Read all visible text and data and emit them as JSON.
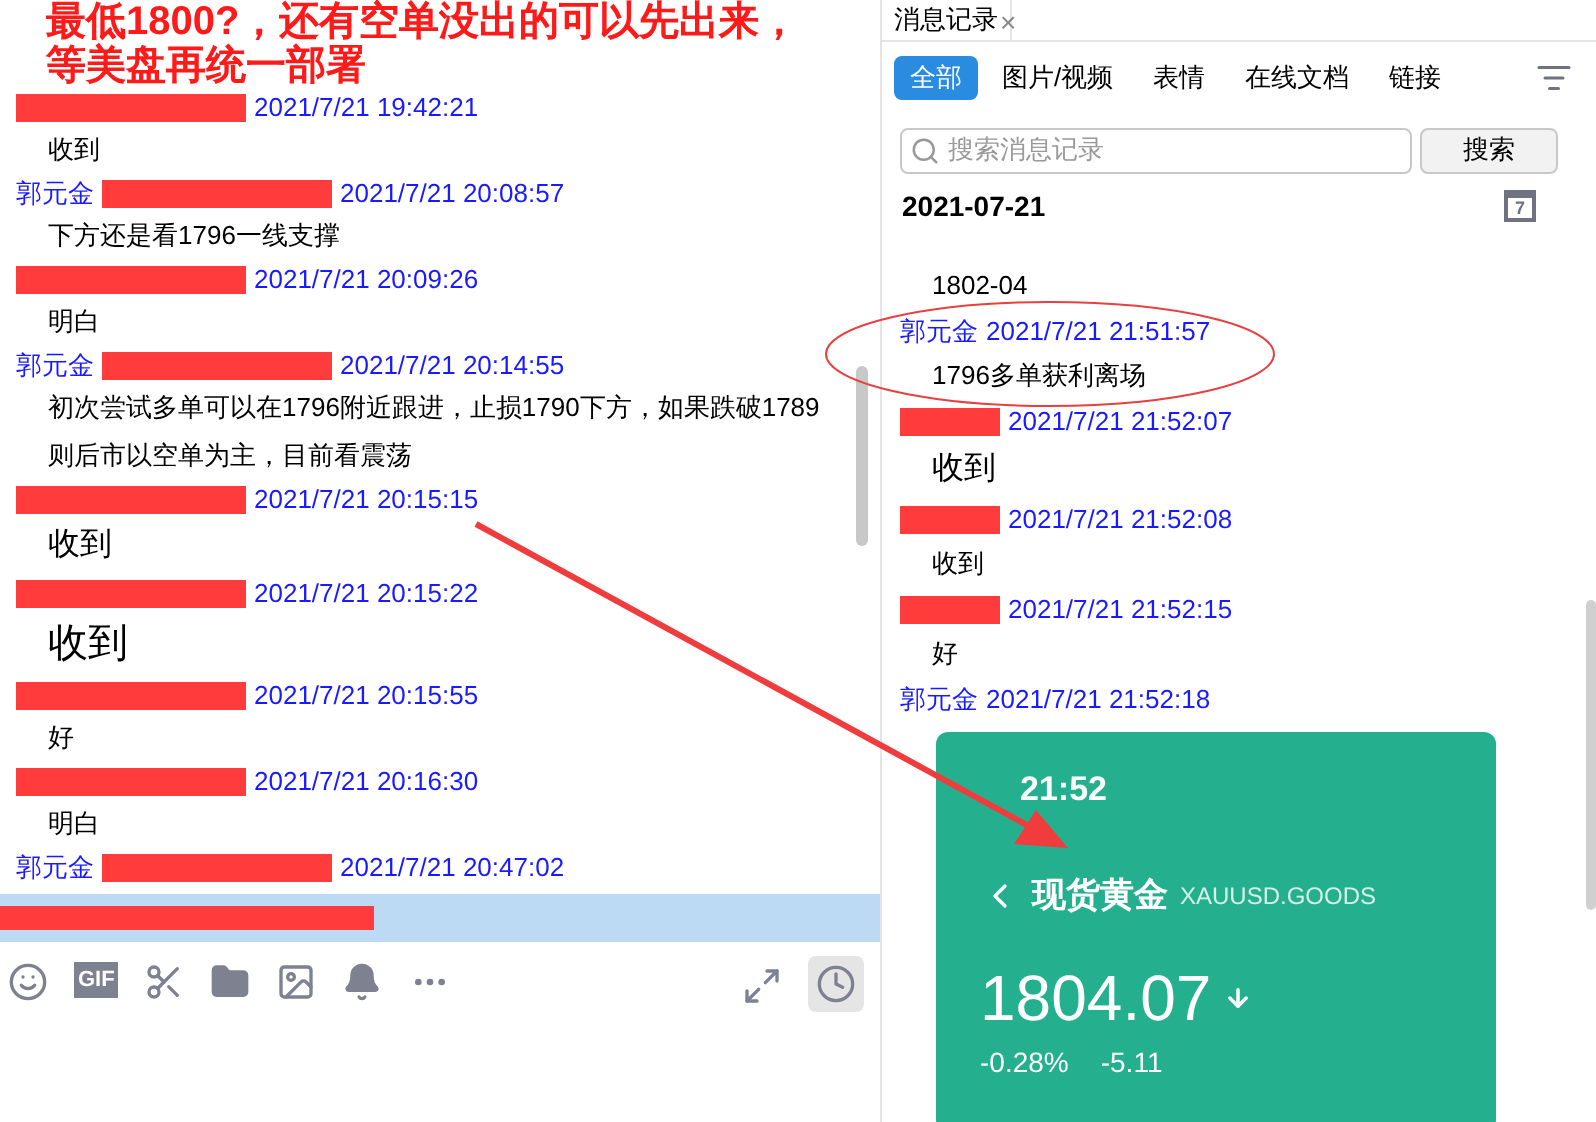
{
  "annotation": {
    "lines": [
      "最低1800?，还有空单没出的可以先出来，",
      "等美盘再统一部署"
    ]
  },
  "chat": {
    "messages": [
      {
        "redacted": true,
        "time": "2021/7/21 19:42:21",
        "kind": "normal",
        "lines": [
          "收到"
        ]
      },
      {
        "sender": "郭元金",
        "redacted": true,
        "time": "2021/7/21 20:08:57",
        "kind": "normal",
        "lines": [
          "下方还是看1796一线支撑"
        ]
      },
      {
        "redacted": true,
        "time": "2021/7/21 20:09:26",
        "kind": "normal",
        "lines": [
          "明白"
        ]
      },
      {
        "sender": "郭元金",
        "redacted": true,
        "time": "2021/7/21 20:14:55",
        "kind": "normal",
        "lines": [
          "初次尝试多单可以在1796附近跟进，止损1790下方，如果跌破1789",
          "则后市以空单为主，目前看震荡"
        ]
      },
      {
        "redacted": true,
        "time": "2021/7/21 20:15:15",
        "kind": "large",
        "lines": [
          "收到"
        ]
      },
      {
        "redacted": true,
        "time": "2021/7/21 20:15:22",
        "kind": "xlarge",
        "lines": [
          "收到"
        ]
      },
      {
        "redacted": true,
        "time": "2021/7/21 20:15:55",
        "kind": "normal",
        "lines": [
          "好"
        ]
      },
      {
        "redacted": true,
        "time": "2021/7/21 20:16:30",
        "kind": "normal",
        "lines": [
          "明白"
        ]
      },
      {
        "sender": "郭元金",
        "redacted": true,
        "time": "2021/7/21 20:47:02"
      }
    ],
    "input_redacted": true,
    "toolbar": {
      "gif_label": "GIF"
    }
  },
  "history": {
    "tab": {
      "label": "消息记录",
      "close": "×"
    },
    "filters": [
      {
        "label": "全部",
        "selected": true
      },
      {
        "label": "图片/视频",
        "selected": false
      },
      {
        "label": "表情",
        "selected": false
      },
      {
        "label": "在线文档",
        "selected": false
      },
      {
        "label": "链接",
        "selected": false
      }
    ],
    "search": {
      "placeholder": "搜索消息记录",
      "button": "搜索"
    },
    "date": "2021-07-21",
    "calendar_day": "7",
    "messages": [
      {
        "kind": "normal",
        "lines": [
          "1802-04"
        ]
      },
      {
        "sender": "郭元金",
        "redacted": false,
        "time": "2021/7/21 21:51:57",
        "kind": "normal",
        "lines": [
          "1796多单获利离场"
        ]
      },
      {
        "redacted": true,
        "time": "2021/7/21 21:52:07",
        "kind": "large",
        "lines": [
          "收到"
        ]
      },
      {
        "redacted": true,
        "time": "2021/7/21 21:52:08",
        "kind": "normal",
        "lines": [
          "收到"
        ]
      },
      {
        "redacted": true,
        "time": "2021/7/21 21:52:15",
        "kind": "normal",
        "lines": [
          "好"
        ]
      },
      {
        "sender": "郭元金",
        "redacted": false,
        "time": "2021/7/21 21:52:18",
        "kind": "card"
      }
    ],
    "card": {
      "time": "21:52",
      "name": "现货黄金",
      "code": "XAUUSD.GOODS",
      "price": "1804.07",
      "change_pct": "-0.28%",
      "change": "-5.11"
    }
  }
}
